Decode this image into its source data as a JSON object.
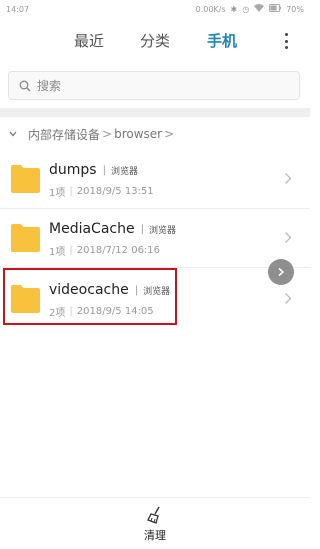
{
  "status_bar": {
    "time": "14:07",
    "network_speed": "0.00K/s",
    "battery": "70%",
    "icons": [
      "bluetooth-icon",
      "alarm-icon",
      "wifi-icon",
      "battery-icon"
    ]
  },
  "tabs": {
    "recent": "最近",
    "category": "分类",
    "phone": "手机",
    "active": "phone"
  },
  "search": {
    "placeholder": "搜索"
  },
  "breadcrumb": {
    "root": "内部存储设备",
    "separator": ">",
    "current": "browser"
  },
  "folders": [
    {
      "name": "dumps",
      "tag": "浏览器",
      "count": "1项",
      "date": "2018/9/5 13:51"
    },
    {
      "name": "MediaCache",
      "tag": "浏览器",
      "count": "1项",
      "date": "2018/7/12 06:16"
    },
    {
      "name": "videocache",
      "tag": "浏览器",
      "count": "2项",
      "date": "2018/9/5 14:05"
    }
  ],
  "bottom_bar": {
    "clean_label": "清理"
  },
  "colors": {
    "accent": "#1e87b3",
    "folder": "#f9c23c",
    "highlight": "#c8141c"
  }
}
